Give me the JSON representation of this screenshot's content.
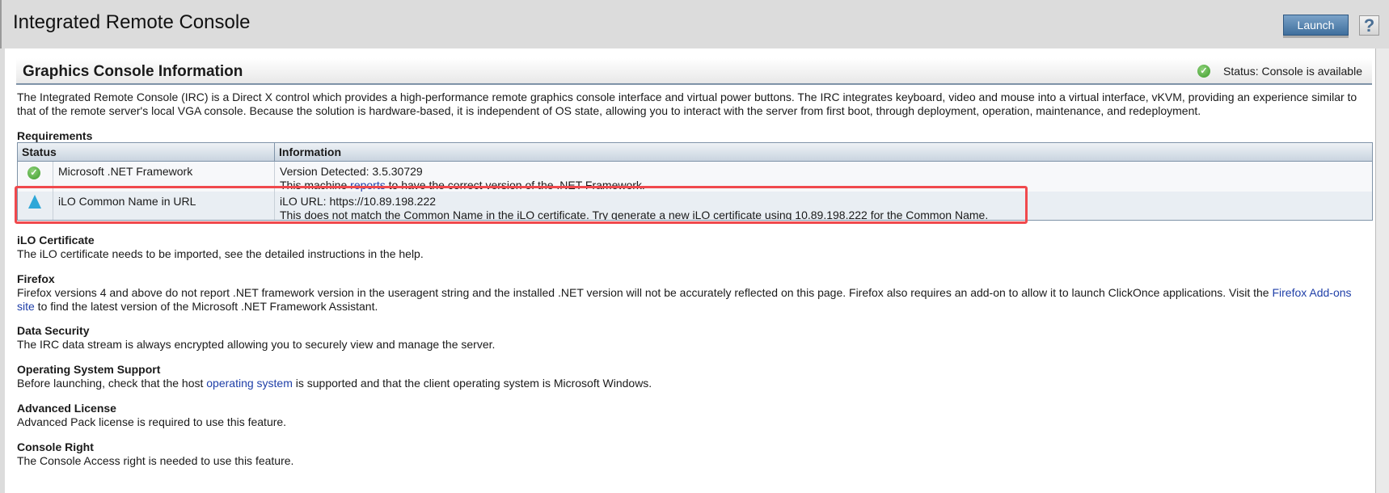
{
  "window": {
    "title": "Integrated Remote Console",
    "launch_label": "Launch",
    "help_label": "?"
  },
  "header": {
    "title": "Graphics Console Information",
    "status": "Status: Console is available",
    "status_icon": "check-circle-icon"
  },
  "description": "The Integrated Remote Console (IRC) is a Direct X control which provides a high-performance remote graphics console interface and virtual power buttons. The IRC integrates keyboard, video and mouse into a virtual interface, vKVM, providing an experience similar to that of the remote server's local VGA console. Because the solution is hardware-based, it is independent of OS state, allowing you to interact with the server from first boot, through deployment, operation, maintenance, and redeployment.",
  "requirements": {
    "heading": "Requirements",
    "columns": [
      "Status",
      "Information"
    ],
    "rows": [
      {
        "status": "ok",
        "name": "Microsoft .NET Framework",
        "info1": "Version Detected: 3.5.30729",
        "info2_pre": "This machine ",
        "info2_link": "reports",
        "info2_post": " to have the correct version of the .NET Framework."
      },
      {
        "status": "warning",
        "name": "iLO Common Name in URL",
        "info1": "iLO URL: https://10.89.198.222",
        "info2_pre": "This does not match the Common Name in the iLO certificate. Try generate a new iLO certificate using 10.89.198.222 for the Common Name."
      }
    ]
  },
  "sections": [
    {
      "title": "iLO Certificate",
      "text": "The iLO certificate needs to be imported, see the detailed instructions in the help."
    },
    {
      "title": "Firefox",
      "pre": "Firefox versions 4 and above do not report .NET framework version in the useragent string and the installed .NET version will not be accurately reflected on this page. Firefox also requires an add-on to allow it to launch ClickOnce applications. Visit the ",
      "link": "Firefox Add-ons site",
      "post": " to find the latest version of the Microsoft .NET Framework Assistant."
    },
    {
      "title": "Data Security",
      "text": "The IRC data stream is always encrypted allowing you to securely view and manage the server."
    },
    {
      "title": "Operating System Support",
      "pre": "Before launching, check that the host ",
      "link": "operating system",
      "post": " is supported and that the client operating system is Microsoft Windows."
    },
    {
      "title": "Advanced License",
      "text": "Advanced Pack license is required to use this feature."
    },
    {
      "title": "Console Right",
      "text": "The Console Access right is needed to use this feature."
    }
  ],
  "colors": {
    "accent": "#3f6f9d",
    "highlight": "#f0494d",
    "link": "#1f3fa8",
    "ok": "#3c9a2a",
    "warning": "#2ea7d8"
  }
}
